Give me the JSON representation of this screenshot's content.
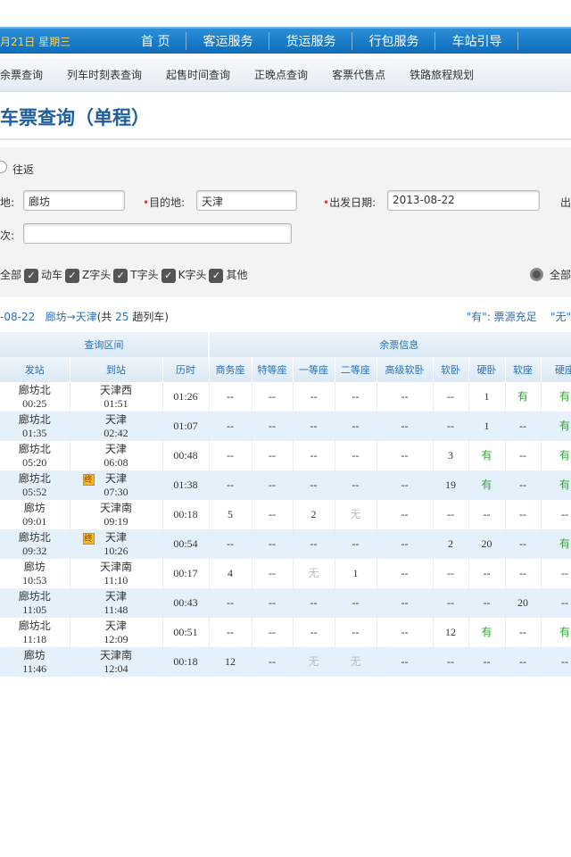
{
  "topnav": {
    "date": "月21日 星期三",
    "items": [
      "首 页",
      "客运服务",
      "货运服务",
      "行包服务",
      "车站引导"
    ]
  },
  "subnav": [
    "余票查询",
    "列车时刻表查询",
    "起售时间查询",
    "正晚点查询",
    "客票代售点",
    "铁路旅程规划"
  ],
  "title": "车票查询（单程）",
  "form": {
    "roundtrip": "往返",
    "from_label": "地:",
    "from_value": "廊坊",
    "to_label": "目的地:",
    "to_value": "天津",
    "date_label": "出发日期:",
    "date_value": "2013-08-22",
    "extra_label": "出",
    "train_label": "次:",
    "train_value": "",
    "types": [
      "全部",
      "动车",
      "Z字头",
      "T字头",
      "K字头",
      "其他"
    ],
    "right_radio": "全部"
  },
  "summary": {
    "date": "-08-22",
    "route": "廊坊→天津",
    "count_prefix": "(共 ",
    "count": "25",
    "count_suffix": " 趟列车)"
  },
  "legend": {
    "yes": "\"有\": 票源充足",
    "no": "\"无\""
  },
  "table": {
    "group1": "查询区间",
    "group2": "余票信息",
    "headers": [
      "发站",
      "到站",
      "历时",
      "商务座",
      "特等座",
      "一等座",
      "二等座",
      "高级软卧",
      "软卧",
      "硬卧",
      "软座",
      "硬座"
    ],
    "rows": [
      {
        "from": "廊坊北",
        "dep": "00:25",
        "to": "天津西",
        "arr": "01:51",
        "badge": "",
        "dur": "01:26",
        "seats": [
          "--",
          "--",
          "--",
          "--",
          "--",
          "--",
          "1",
          "有",
          "有"
        ]
      },
      {
        "from": "廊坊北",
        "dep": "01:35",
        "to": "天津",
        "arr": "02:42",
        "badge": "",
        "dur": "01:07",
        "seats": [
          "--",
          "--",
          "--",
          "--",
          "--",
          "--",
          "1",
          "--",
          "有"
        ]
      },
      {
        "from": "廊坊北",
        "dep": "05:20",
        "to": "天津",
        "arr": "06:08",
        "badge": "",
        "dur": "00:48",
        "seats": [
          "--",
          "--",
          "--",
          "--",
          "--",
          "3",
          "有",
          "--",
          "有"
        ]
      },
      {
        "from": "廊坊北",
        "dep": "05:52",
        "to": "天津",
        "arr": "07:30",
        "badge": "终",
        "dur": "01:38",
        "seats": [
          "--",
          "--",
          "--",
          "--",
          "--",
          "19",
          "有",
          "--",
          "有"
        ]
      },
      {
        "from": "廊坊",
        "dep": "09:01",
        "to": "天津南",
        "arr": "09:19",
        "badge": "",
        "dur": "00:18",
        "seats": [
          "5",
          "--",
          "2",
          "无",
          "--",
          "--",
          "--",
          "--",
          "--"
        ]
      },
      {
        "from": "廊坊北",
        "dep": "09:32",
        "to": "天津",
        "arr": "10:26",
        "badge": "终",
        "dur": "00:54",
        "seats": [
          "--",
          "--",
          "--",
          "--",
          "--",
          "2",
          "20",
          "--",
          "有"
        ]
      },
      {
        "from": "廊坊",
        "dep": "10:53",
        "to": "天津南",
        "arr": "11:10",
        "badge": "",
        "dur": "00:17",
        "seats": [
          "4",
          "--",
          "无",
          "1",
          "--",
          "--",
          "--",
          "--",
          "--"
        ]
      },
      {
        "from": "廊坊北",
        "dep": "11:05",
        "to": "天津",
        "arr": "11:48",
        "badge": "",
        "dur": "00:43",
        "seats": [
          "--",
          "--",
          "--",
          "--",
          "--",
          "--",
          "--",
          "20",
          "--"
        ]
      },
      {
        "from": "廊坊北",
        "dep": "11:18",
        "to": "天津",
        "arr": "12:09",
        "badge": "",
        "dur": "00:51",
        "seats": [
          "--",
          "--",
          "--",
          "--",
          "--",
          "12",
          "有",
          "--",
          "有"
        ]
      },
      {
        "from": "廊坊",
        "dep": "11:46",
        "to": "天津南",
        "arr": "12:04",
        "badge": "",
        "dur": "00:18",
        "seats": [
          "12",
          "--",
          "无",
          "无",
          "--",
          "--",
          "--",
          "--",
          "--"
        ]
      }
    ]
  }
}
